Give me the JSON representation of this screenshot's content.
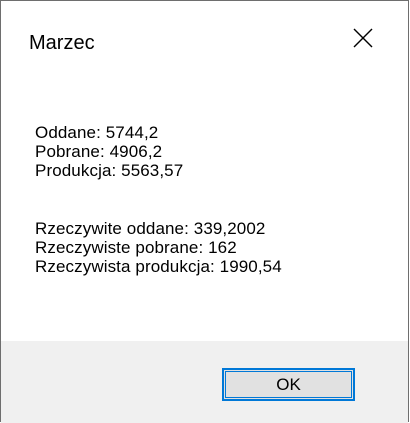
{
  "window": {
    "title": "Marzec",
    "close_icon": "close-icon"
  },
  "message": {
    "lines": [
      "Oddane: 5744,2",
      "Pobrane: 4906,2",
      "Produkcja: 5563,57",
      "Rzeczywite oddane: 339,2002",
      "Rzeczywiste pobrane: 162",
      "Rzeczywista produkcja: 1990,54"
    ]
  },
  "buttons": {
    "ok_label": "OK"
  },
  "colors": {
    "accent": "#0078d7",
    "footer_bg": "#f0f0f0",
    "button_bg": "#e1e1e1"
  }
}
